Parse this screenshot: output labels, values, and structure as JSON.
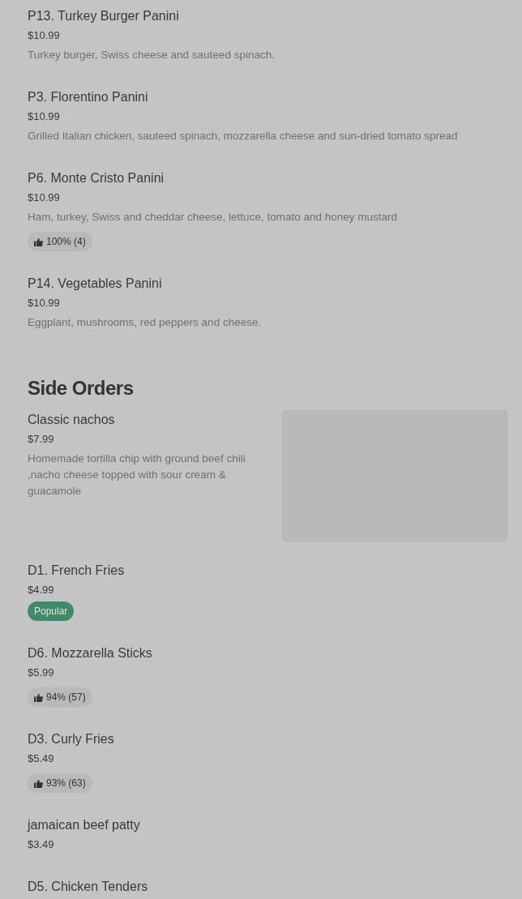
{
  "sections": [
    {
      "items": [
        {
          "name": "P13. Turkey Burger Panini",
          "price": "$10.99",
          "description": "Turkey burger, Swiss cheese and sauteed spinach."
        },
        {
          "name": "P3. Florentino Panini",
          "price": "$10.99",
          "description": "Grilled Italian chicken, sauteed spinach, mozzarella cheese and sun-dried tomato spread"
        },
        {
          "name": "P6. Monte Cristo Panini",
          "price": "$10.99",
          "description": "Ham, turkey, Swiss and cheddar cheese, lettuce, tomato and honey mustard",
          "rating": "100% (4)"
        },
        {
          "name": "P14. Vegetables Panini",
          "price": "$10.99",
          "description": "Eggplant, mushrooms, red peppers and cheese."
        }
      ]
    },
    {
      "title": "Side Orders",
      "items": [
        {
          "name": "Classic nachos",
          "price": "$7.99",
          "description": "Homemade tortilla chip with ground beef chili ,nacho cheese topped with sour cream & guacamole",
          "has_image": true
        },
        {
          "name": "D1. French Fries",
          "price": "$4.99",
          "badge": "Popular"
        },
        {
          "name": "D6. Mozzarella Sticks",
          "price": "$5.99",
          "rating": "94% (57)"
        },
        {
          "name": "D3. Curly Fries",
          "price": "$5.49",
          "rating": "93% (63)"
        },
        {
          "name": "jamaican beef patty",
          "price": "$3.49"
        },
        {
          "name": "D5. Chicken Tenders"
        }
      ]
    }
  ]
}
